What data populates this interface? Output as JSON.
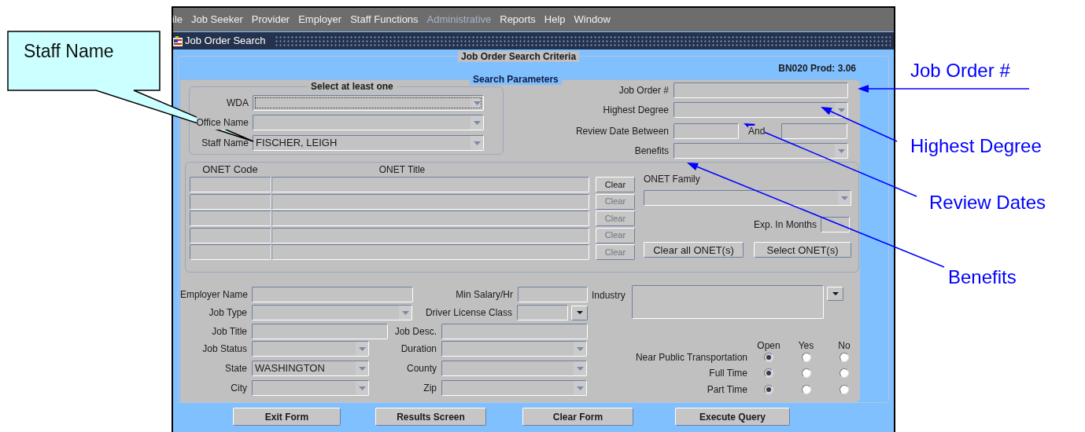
{
  "menu": [
    {
      "label": "ile",
      "disabled": false
    },
    {
      "label": "Job Seeker",
      "disabled": false
    },
    {
      "label": "Provider",
      "disabled": false
    },
    {
      "label": "Employer",
      "disabled": false
    },
    {
      "label": "Staff Functions",
      "disabled": false
    },
    {
      "label": "Administrative",
      "disabled": true
    },
    {
      "label": "Reports",
      "disabled": false
    },
    {
      "label": "Help",
      "disabled": false
    },
    {
      "label": "Window",
      "disabled": false
    }
  ],
  "window_title": "Job Order Search",
  "criteria": {
    "title": "Job Order Search Criteria",
    "version": "BN020 Prod: 3.06"
  },
  "search_parameters": {
    "title": "Search Parameters",
    "group": {
      "title": "Select at least one",
      "fields": [
        {
          "label": "WDA",
          "focused": true
        },
        {
          "label": "Office Name",
          "focused": false
        },
        {
          "label": "Staff Name",
          "value": "FISCHER, LEIGH",
          "focused": false
        }
      ]
    },
    "fields": [
      {
        "label": "Job Order #",
        "kind": "text"
      },
      {
        "label": "Highest Degree",
        "kind": "dropdown"
      },
      {
        "label": "Review Date Between",
        "kind": "range",
        "and_label": "And"
      },
      {
        "label": "Benefits",
        "kind": "dropdown"
      }
    ]
  },
  "onet": {
    "columns": [
      "ONET Code",
      "ONET Title"
    ],
    "rows": [
      {
        "clear": "Clear",
        "disabled": false
      },
      {
        "clear": "Clear",
        "disabled": true
      },
      {
        "clear": "Clear",
        "disabled": true
      },
      {
        "clear": "Clear",
        "disabled": true
      },
      {
        "clear": "Clear",
        "disabled": true
      }
    ],
    "family_label": "ONET Family",
    "exp_label": "Exp. In Months",
    "buttons": [
      "Clear all ONET(s)",
      "Select ONET(s)"
    ]
  },
  "details": [
    [
      {
        "label": "Employer Name",
        "kind": "text"
      },
      {
        "label": "Min Salary/Hr",
        "kind": "text"
      }
    ],
    [
      {
        "label": "Job Type",
        "kind": "dropdown"
      },
      {
        "label": "Driver License Class",
        "kind": "picker"
      }
    ],
    [
      {
        "label": "Job Title",
        "kind": "text"
      },
      {
        "label": "Job Desc.",
        "kind": "text"
      }
    ],
    [
      {
        "label": "Job Status",
        "kind": "dropdown"
      },
      {
        "label": "Duration",
        "kind": "dropdown"
      }
    ],
    [
      {
        "label": "State",
        "kind": "dropdown",
        "value": "WASHINGTON"
      },
      {
        "label": "County",
        "kind": "dropdown"
      }
    ],
    [
      {
        "label": "City",
        "kind": "dropdown"
      },
      {
        "label": "Zip",
        "kind": "dropdown"
      }
    ]
  ],
  "industry": {
    "label": "Industry"
  },
  "options": {
    "columns": [
      "Open",
      "Yes",
      "No"
    ],
    "rows": [
      {
        "label": "Near Public Transportation",
        "choices": [
          {
            "selected": true
          },
          {
            "selected": false
          },
          {
            "selected": false
          }
        ]
      },
      {
        "label": "Full Time",
        "choices": [
          {
            "selected": true
          },
          {
            "selected": false
          },
          {
            "selected": false
          }
        ]
      },
      {
        "label": "Part Time",
        "choices": [
          {
            "selected": true
          },
          {
            "selected": false
          },
          {
            "selected": false
          }
        ]
      }
    ]
  },
  "buttons": [
    {
      "label": "Exit Form"
    },
    {
      "label": "Results Screen"
    },
    {
      "label": "Clear Form"
    },
    {
      "label": "Execute Query"
    }
  ],
  "annotations": {
    "callout": "Staff Name",
    "labels": [
      "Job Order #",
      "Highest Degree",
      "Review Dates",
      "Benefits"
    ]
  }
}
